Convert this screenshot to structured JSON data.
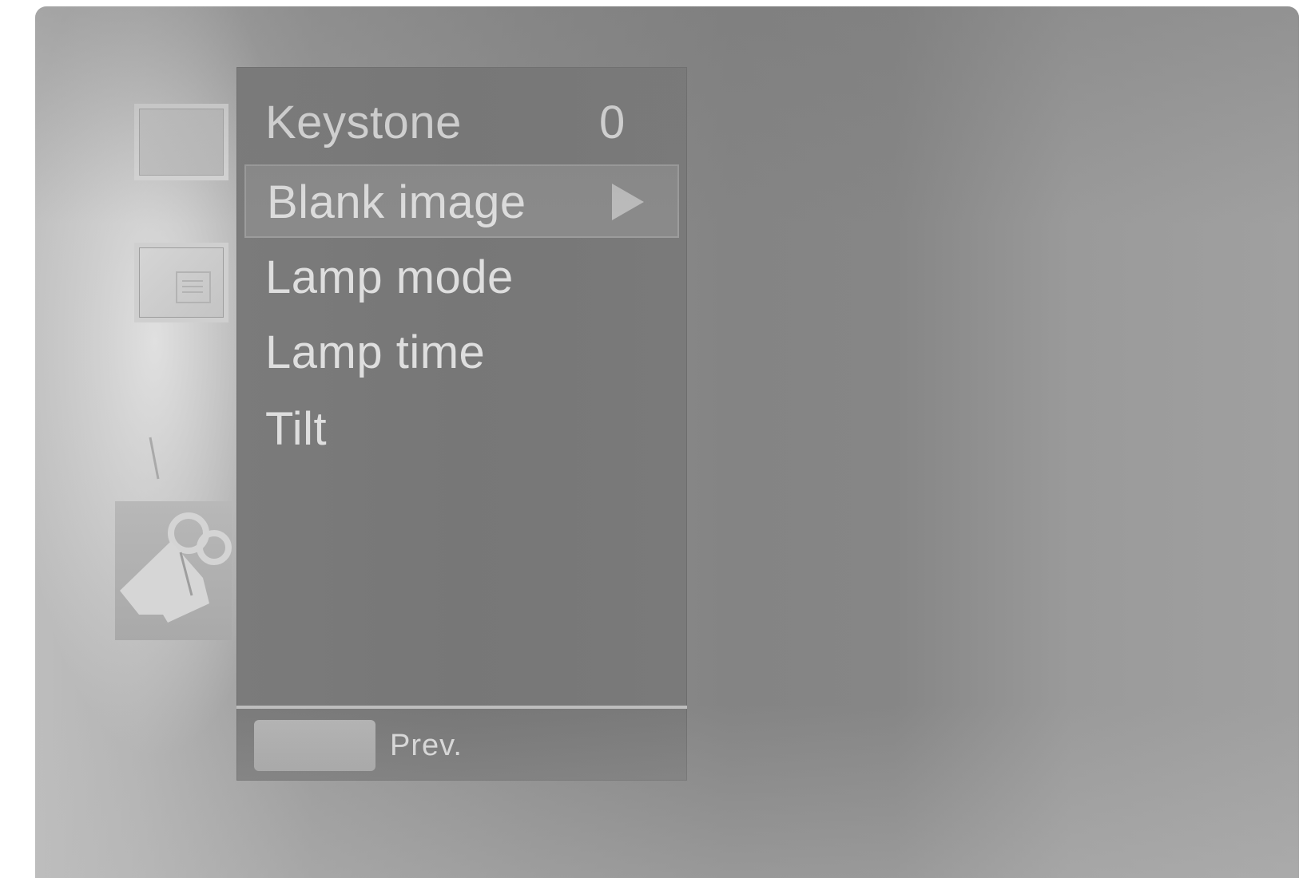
{
  "categories": [
    {
      "name": "picture-icon"
    },
    {
      "name": "option-icon"
    },
    {
      "name": "audio-icon"
    },
    {
      "name": "special-icon"
    }
  ],
  "menu": {
    "items": [
      {
        "label": "Keystone",
        "value": "0"
      },
      {
        "label": "Blank image",
        "value": "",
        "indicator": "right-arrow-icon",
        "selected": true
      },
      {
        "label": "Lamp mode",
        "value": ""
      },
      {
        "label": "Lamp time",
        "value": ""
      },
      {
        "label": "Tilt",
        "value": ""
      }
    ]
  },
  "footer": {
    "prev_label": "Prev."
  },
  "colors": {
    "panel": "#797979",
    "text": "#dedede",
    "highlight_border": "#9c9c9c"
  }
}
